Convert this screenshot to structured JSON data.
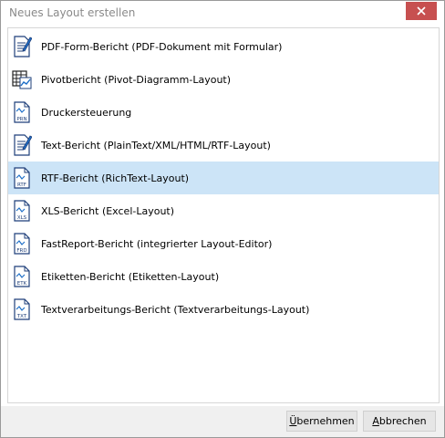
{
  "window": {
    "title": "Neues Layout erstellen"
  },
  "items": [
    {
      "label": "PDF-Form-Bericht (PDF-Dokument mit Formular)",
      "icon": "form-doc-icon"
    },
    {
      "label": "Pivotbericht (Pivot-Diagramm-Layout)",
      "icon": "pivot-table-icon"
    },
    {
      "label": "Druckersteuerung",
      "icon": "prn-file-icon",
      "tag": "PRN"
    },
    {
      "label": "Text-Bericht (PlainText/XML/HTML/RTF-Layout)",
      "icon": "text-doc-icon"
    },
    {
      "label": "RTF-Bericht (RichText-Layout)",
      "icon": "rtf-file-icon",
      "tag": "RTF",
      "selected": true
    },
    {
      "label": "XLS-Bericht (Excel-Layout)",
      "icon": "xls-file-icon",
      "tag": "XLS"
    },
    {
      "label": "FastReport-Bericht (integrierter Layout-Editor)",
      "icon": "frd-file-icon",
      "tag": "FRD"
    },
    {
      "label": "Etiketten-Bericht (Etiketten-Layout)",
      "icon": "etk-file-icon",
      "tag": "ETK"
    },
    {
      "label": "Textverarbeitungs-Bericht (Textverarbeitungs-Layout)",
      "icon": "txt-file-icon",
      "tag": "TXT"
    }
  ],
  "buttons": {
    "ok_accel": "Ü",
    "ok_rest": "bernehmen",
    "cancel_accel": "A",
    "cancel_rest": "bbrechen"
  },
  "colors": {
    "selection": "#cce4f7",
    "close": "#c75050",
    "accent": "#1e6fc8"
  }
}
